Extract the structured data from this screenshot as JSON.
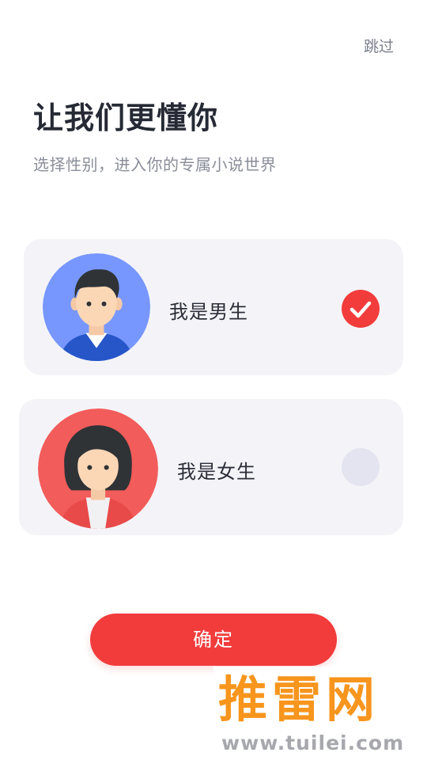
{
  "header": {
    "skip_label": "跳过"
  },
  "intro": {
    "title": "让我们更懂你",
    "subtitle": "选择性别，进入你的专属小说世界"
  },
  "options": [
    {
      "label": "我是男生",
      "selected": true,
      "avatar_icon": "male-avatar-icon",
      "avatar_bg": "#7797ff"
    },
    {
      "label": "我是女生",
      "selected": false,
      "avatar_icon": "female-avatar-icon",
      "avatar_bg": "#f25c5a"
    }
  ],
  "confirm_label": "确定",
  "watermark": {
    "text": "推雷网",
    "url": "www.tuilei.com"
  },
  "colors": {
    "accent": "#f23c3c",
    "card_bg": "#f4f4f8",
    "unselected_radio": "#e3e4ef",
    "watermark": "#f7951d"
  }
}
